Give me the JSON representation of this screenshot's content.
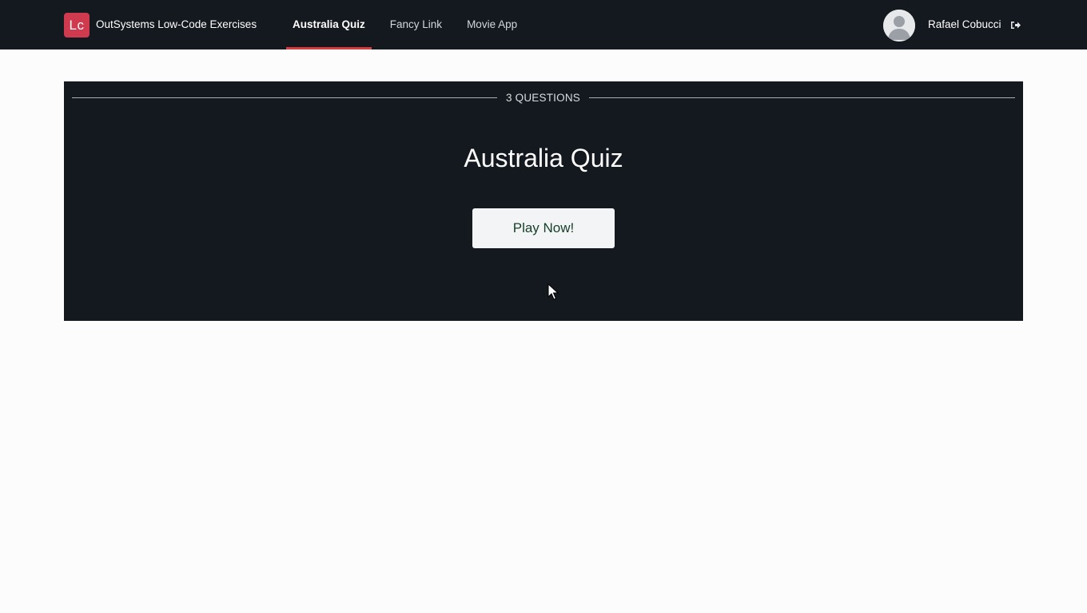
{
  "header": {
    "logo_text": "Lc",
    "app_title": "OutSystems Low-Code Exercises",
    "nav": [
      {
        "label": "Australia Quiz",
        "active": true
      },
      {
        "label": "Fancy Link",
        "active": false
      },
      {
        "label": "Movie App",
        "active": false
      }
    ],
    "user_name": "Rafael Cobucci",
    "avatar_icon": "user-avatar-icon",
    "logout_icon": "sign-out-icon"
  },
  "hero": {
    "questions_label": "3 QUESTIONS",
    "title": "Australia Quiz",
    "play_label": "Play Now!"
  },
  "colors": {
    "topbar_bg": "#14191f",
    "accent": "#d73a3f",
    "logo_bg": "#d03a4e",
    "page_bg": "#fcfcfd",
    "play_text": "#17412a"
  }
}
